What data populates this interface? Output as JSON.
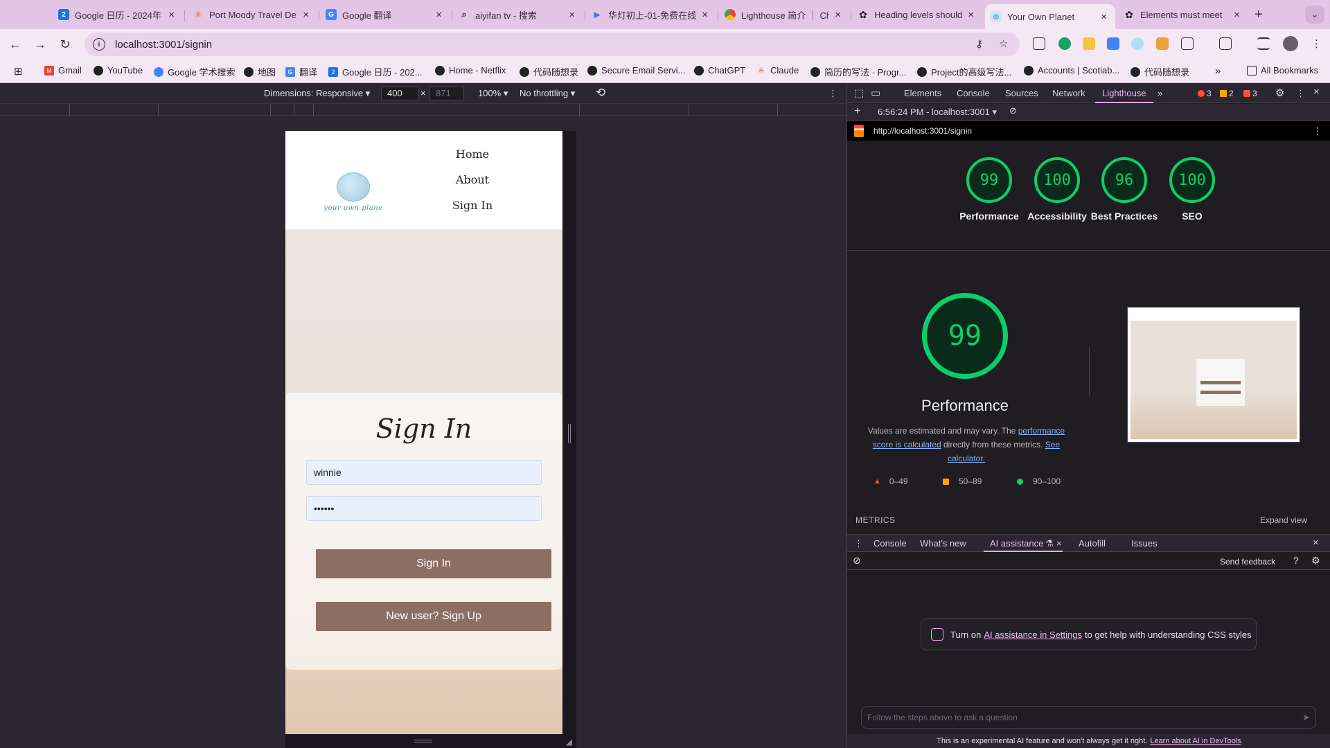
{
  "browser": {
    "tabs": [
      {
        "title": "Google 日历 - 2024年",
        "icon": "calendar-icon",
        "color": "#1a73e8",
        "glyph": "2"
      },
      {
        "title": "Port Moody Travel De",
        "icon": "claude-icon",
        "color": "#d97757",
        "glyph": "✳"
      },
      {
        "title": "Google 翻译",
        "icon": "translate-icon",
        "color": "#4285f4",
        "glyph": "G"
      },
      {
        "title": "aiyifan tv - 搜索",
        "icon": "search-icon",
        "color": "#3b2b3e",
        "glyph": "⌕"
      },
      {
        "title": "华灯初上-01-免费在线",
        "icon": "play-icon",
        "color": "#4b6ef5",
        "glyph": "▶"
      },
      {
        "title": "Lighthouse 简介 ｜ Ch",
        "icon": "chrome-icon",
        "color": "#ea4335",
        "glyph": "◉"
      },
      {
        "title": "Heading levels should",
        "icon": "openai-icon",
        "color": "#1f1f1f",
        "glyph": "✿"
      },
      {
        "title": "Your Own Planet",
        "icon": "planet-icon",
        "color": "#4a8fb5",
        "glyph": "◍"
      },
      {
        "title": "Elements must meet",
        "icon": "openai-icon",
        "color": "#1f1f1f",
        "glyph": "✿"
      }
    ],
    "active_tab_index": 7,
    "new_tab": "+",
    "url": "localhost:3001/signin",
    "bookmarks": [
      {
        "label": "Gmail",
        "icon": "gmail-icon",
        "color": "#ea4335"
      },
      {
        "label": "YouTube",
        "icon": "globe-icon",
        "color": "#222"
      },
      {
        "label": "Google 学术搜索",
        "icon": "scholar-icon",
        "color": "#4285f4"
      },
      {
        "label": "地图",
        "icon": "globe-icon",
        "color": "#222"
      },
      {
        "label": "翻译",
        "icon": "translate-icon",
        "color": "#4285f4"
      },
      {
        "label": "Google 日历 - 202...",
        "icon": "calendar-icon",
        "color": "#1a73e8"
      },
      {
        "label": "Home - Netflix",
        "icon": "globe-icon",
        "color": "#222"
      },
      {
        "label": "代码随想录",
        "icon": "globe-icon",
        "color": "#222"
      },
      {
        "label": "Secure Email Servi...",
        "icon": "globe-icon",
        "color": "#222"
      },
      {
        "label": "ChatGPT",
        "icon": "globe-icon",
        "color": "#222"
      },
      {
        "label": "Claude",
        "icon": "claude-icon",
        "color": "#d97757"
      },
      {
        "label": "简历的写法 · Progr...",
        "icon": "globe-icon",
        "color": "#222"
      },
      {
        "label": "Project的高级写法...",
        "icon": "globe-icon",
        "color": "#222"
      },
      {
        "label": "Accounts | Scotiab...",
        "icon": "globe-icon",
        "color": "#222"
      },
      {
        "label": "代码随想录",
        "icon": "globe-icon",
        "color": "#222"
      }
    ],
    "more_bookmarks": "»",
    "all_bookmarks": "All Bookmarks"
  },
  "device_toolbar": {
    "dimensions_label": "Dimensions: Responsive ▾",
    "width": "400",
    "times": "×",
    "height": "871",
    "zoom": "100% ▾",
    "throttling": "No throttling ▾"
  },
  "site": {
    "logo_text": "your own plane",
    "nav": [
      "Home",
      "About",
      "Sign In"
    ],
    "form": {
      "title": "Sign In",
      "username_value": "winnie",
      "password_value": "••••••",
      "sign_in_button": "Sign In",
      "sign_up_button": "New user? Sign Up"
    }
  },
  "devtools": {
    "tabs": [
      "Elements",
      "Console",
      "Sources",
      "Network",
      "Lighthouse"
    ],
    "active_tab": "Lighthouse",
    "more_tabs": "»",
    "errors": "3",
    "warnings": "2",
    "issues": "3",
    "report_time": "6:56:24 PM - localhost:3001 ▾",
    "report_url": "http://localhost:3001/signin",
    "scores": [
      {
        "label": "Performance",
        "value": 99
      },
      {
        "label": "Accessibility",
        "value": 100
      },
      {
        "label": "Best Practices",
        "value": 96
      },
      {
        "label": "SEO",
        "value": 100
      }
    ],
    "main_score": 99,
    "main_label": "Performance",
    "desc_1": "Values are estimated and may vary. The",
    "desc_link_1": "performance score is calculated",
    "desc_2": "directly from these metrics.",
    "desc_link_2": "See calculator.",
    "legend": [
      {
        "range": "0–49",
        "color": "#ff4e42",
        "shape": "triangle"
      },
      {
        "range": "50–89",
        "color": "#ffa400",
        "shape": "square"
      },
      {
        "range": "90–100",
        "color": "#0cce6b",
        "shape": "circle"
      }
    ],
    "metrics_heading": "METRICS",
    "expand_view": "Expand view",
    "drawer_tabs": [
      "Console",
      "What's new",
      "AI assistance",
      "Autofill",
      "Issues"
    ],
    "active_drawer_tab": "AI assistance",
    "send_feedback": "Send feedback",
    "notice_prefix": "Turn on",
    "notice_link": "AI assistance in Settings",
    "notice_suffix": "to get help with understanding CSS styles",
    "ask_placeholder": "Follow the steps above to ask a question",
    "disclaimer": "This is an experimental AI feature and won't always get it right.",
    "disclaimer_link": "Learn about AI in DevTools"
  }
}
